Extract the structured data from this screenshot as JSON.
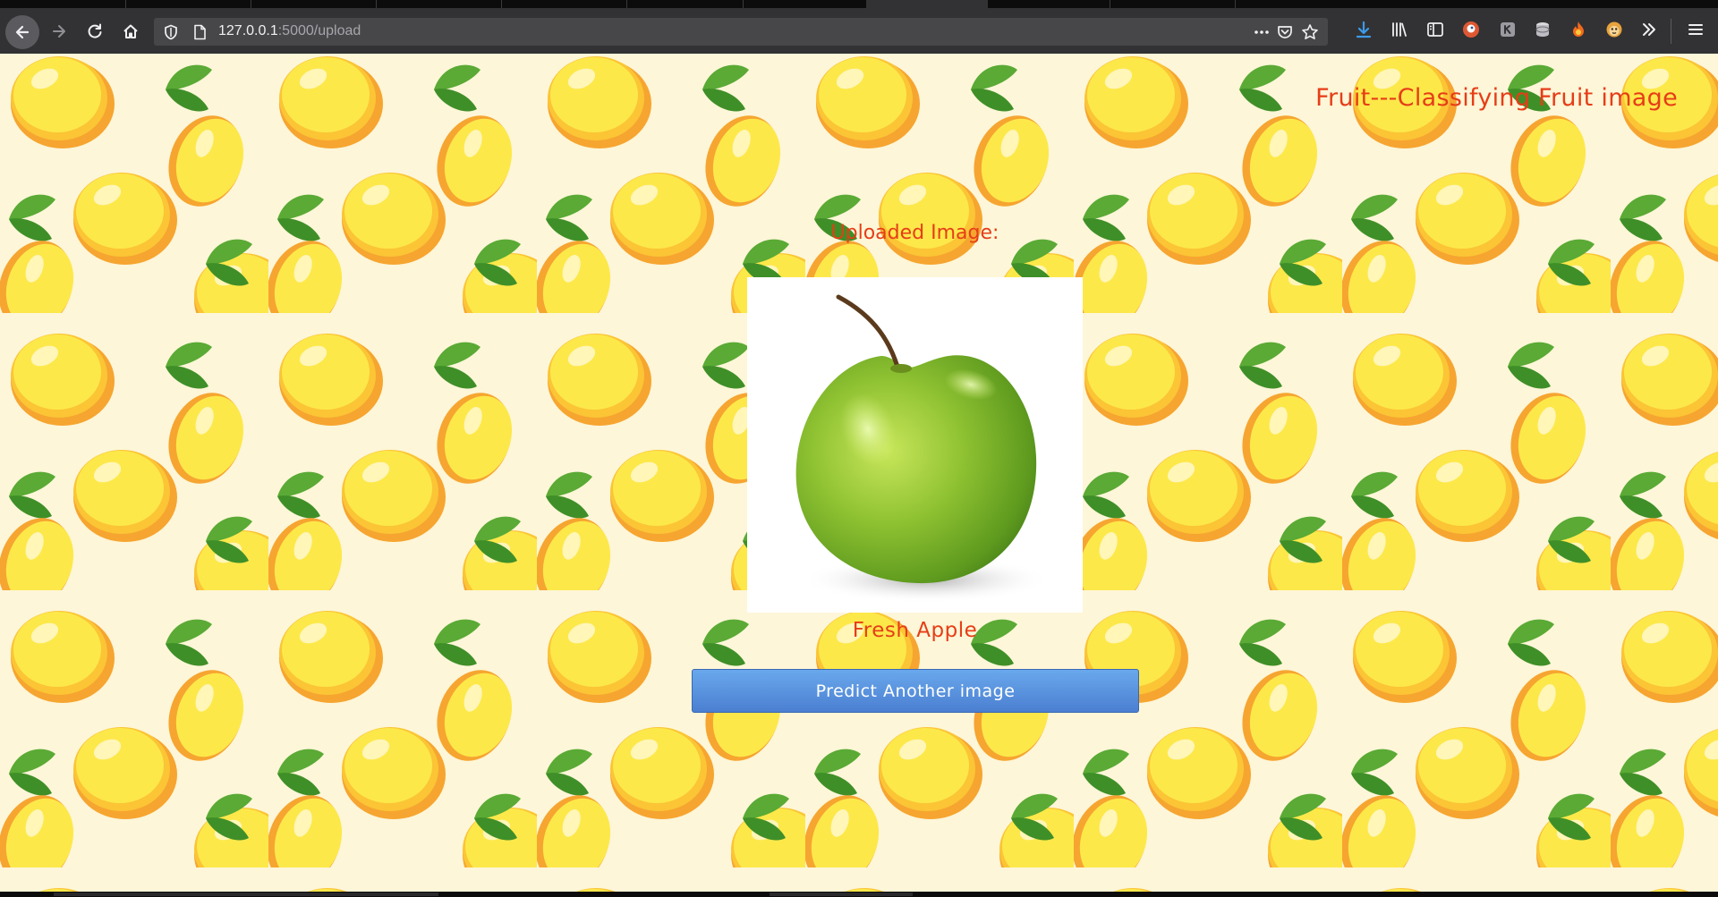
{
  "browser": {
    "url_host": "127.0.0.1",
    "url_path": ":5000/upload",
    "icons": {
      "back": "arrow-left-icon",
      "forward": "arrow-right-icon",
      "reload": "reload-icon",
      "home": "home-icon",
      "shield": "shield-icon",
      "page": "page-icon",
      "more": "ellipsis-icon",
      "pocket": "pocket-icon",
      "bookmark": "star-icon",
      "downloads": "download-icon",
      "library": "library-icon",
      "sidebar": "sidebar-icon",
      "menu": "hamburger-icon"
    }
  },
  "page": {
    "title": "Fruit---Classifying Fruit image",
    "uploaded_label": "Uploaded Image:",
    "result": "Fresh Apple",
    "predict_button": "Predict Another image"
  },
  "colors": {
    "accent_text": "#e63d17",
    "button_top": "#69a8ec",
    "button_bottom": "#4b7fd1",
    "background": "#fdf6d8"
  }
}
